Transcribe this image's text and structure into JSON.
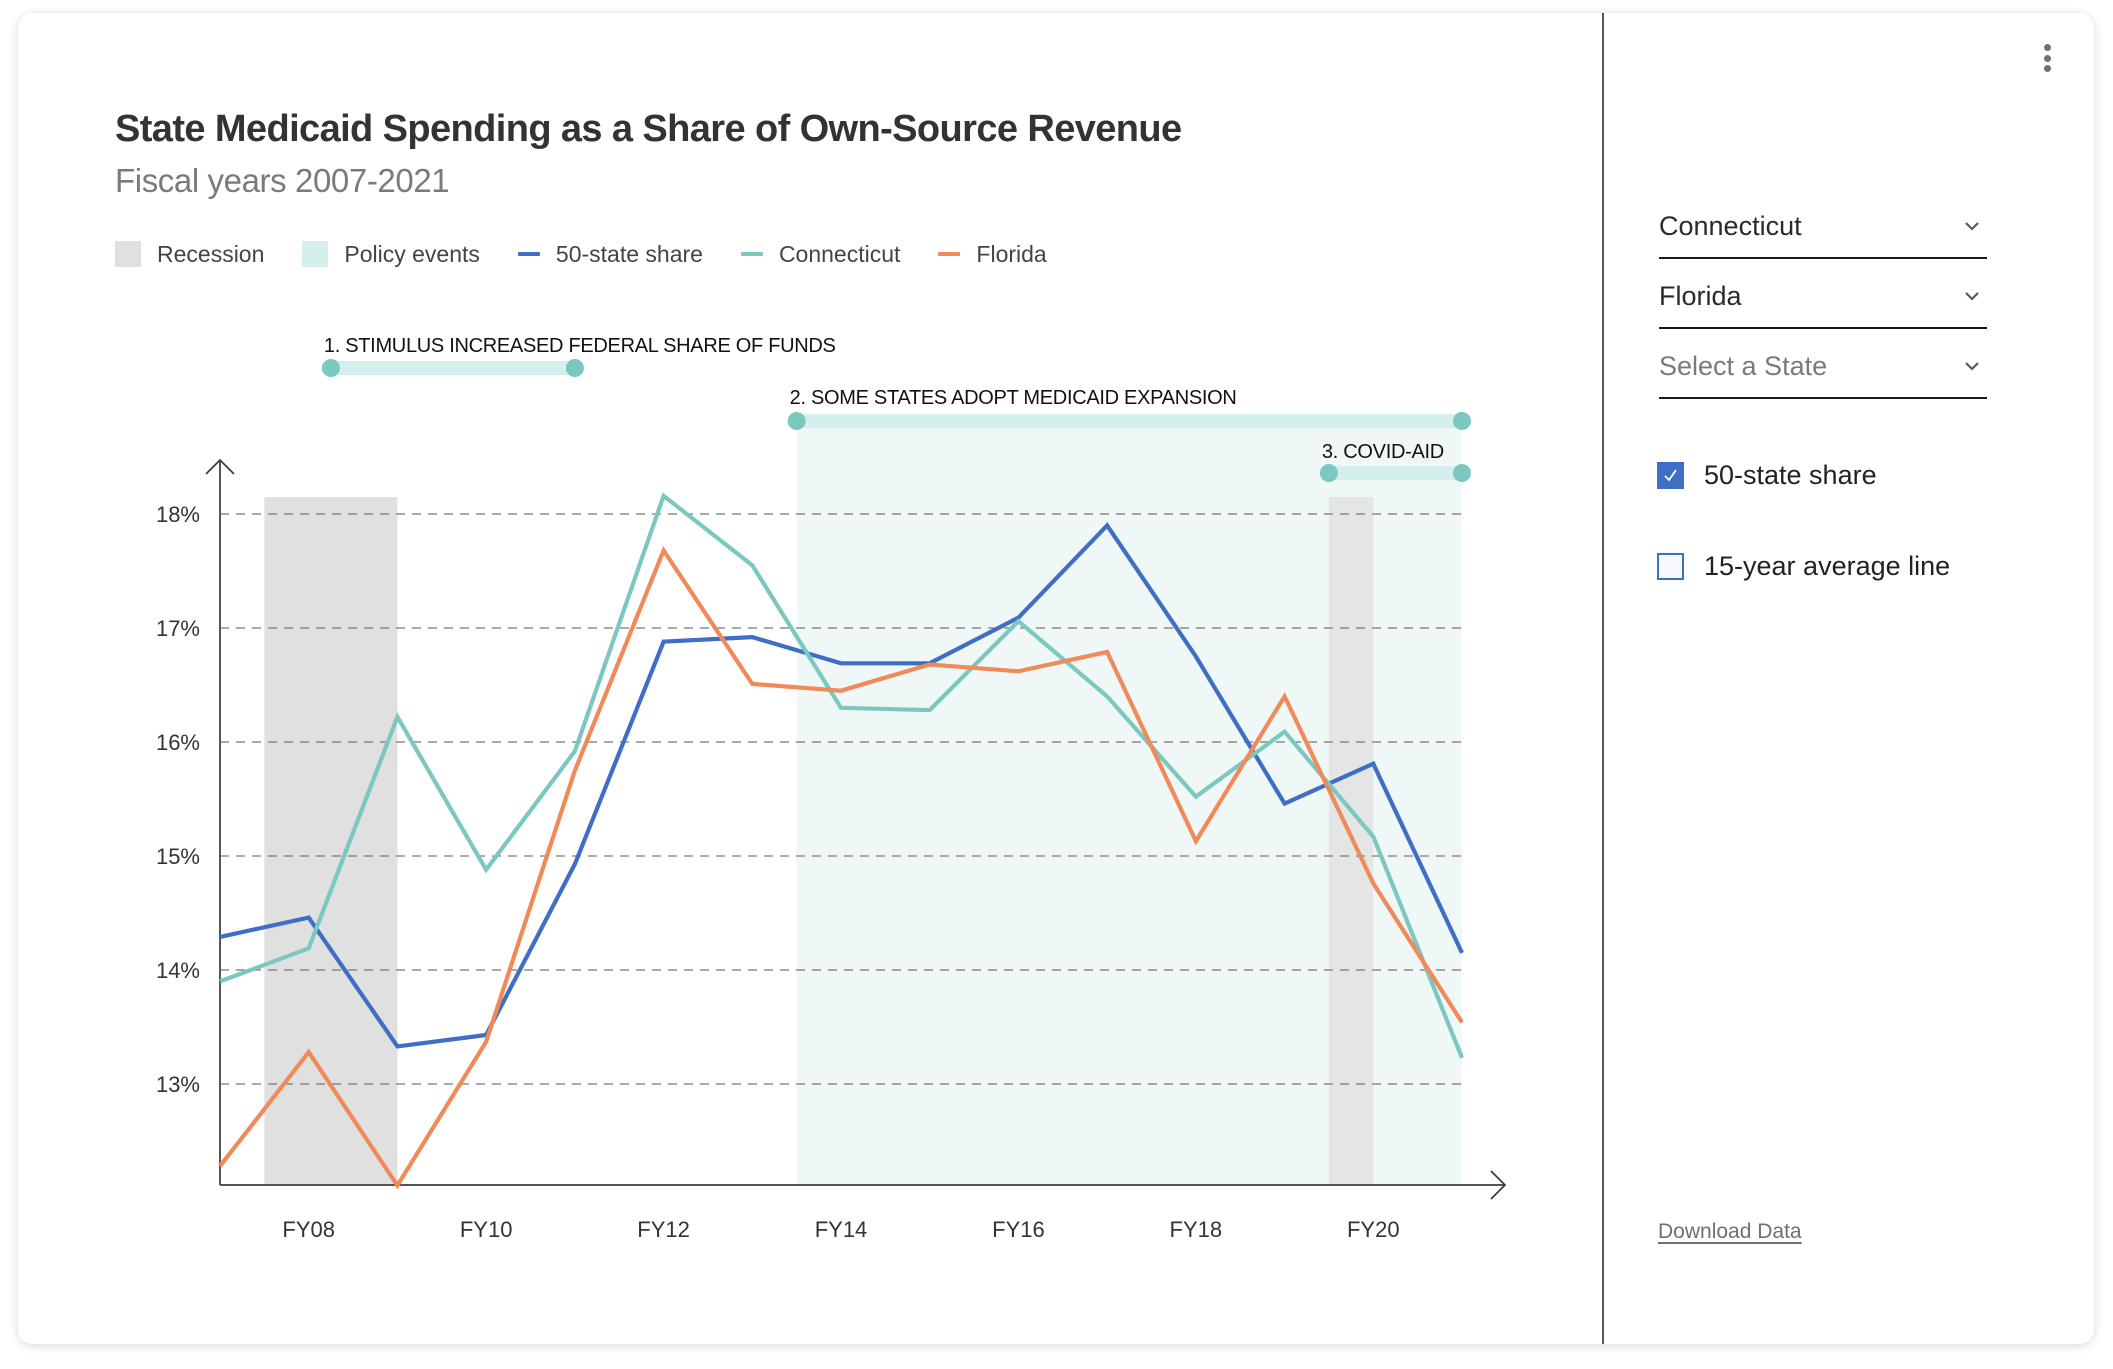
{
  "header": {
    "title": "State Medicaid Spending as a Share of Own-Source Revenue",
    "subtitle": "Fiscal years 2007-2021"
  },
  "legend": [
    {
      "label": "Recession",
      "kind": "swatch",
      "color": "#e0e0e0"
    },
    {
      "label": "Policy events",
      "kind": "swatch",
      "color": "#d5eeee"
    },
    {
      "label": "50-state share",
      "kind": "line",
      "color": "#3f6fc4"
    },
    {
      "label": "Connecticut",
      "kind": "line",
      "color": "#7ac8c0"
    },
    {
      "label": "Florida",
      "kind": "line",
      "color": "#f08a58"
    }
  ],
  "controls": {
    "menu_icon": "kebab-vertical-icon",
    "dropdowns": [
      {
        "value": "Connecticut",
        "placeholder": false
      },
      {
        "value": "Florida",
        "placeholder": false
      },
      {
        "value": "Select a State",
        "placeholder": true
      }
    ],
    "checkboxes": [
      {
        "label": "50-state share",
        "checked": true
      },
      {
        "label": "15-year average line",
        "checked": false
      }
    ],
    "download_label": "Download Data"
  },
  "colors": {
    "recession": "#e0e0e0",
    "policy_band": "#f0f8f7",
    "policy_pill": "#d5eeee",
    "policy_dot": "#7ac8c0",
    "grid": "#777777",
    "axis": "#555555"
  },
  "chart_data": {
    "type": "line",
    "title": "State Medicaid Spending as a Share of Own-Source Revenue",
    "subtitle": "Fiscal years 2007-2021",
    "xlabel": "",
    "ylabel": "",
    "x": [
      2007,
      2008,
      2009,
      2010,
      2011,
      2012,
      2013,
      2014,
      2015,
      2016,
      2017,
      2018,
      2019,
      2020,
      2021
    ],
    "x_tick_labels": [
      {
        "x": 2008,
        "label": "FY08"
      },
      {
        "x": 2010,
        "label": "FY10"
      },
      {
        "x": 2012,
        "label": "FY12"
      },
      {
        "x": 2014,
        "label": "FY14"
      },
      {
        "x": 2016,
        "label": "FY16"
      },
      {
        "x": 2018,
        "label": "FY18"
      },
      {
        "x": 2020,
        "label": "FY20"
      }
    ],
    "y_ticks": [
      {
        "value": 13,
        "label": "13%"
      },
      {
        "value": 14,
        "label": "14%"
      },
      {
        "value": 15,
        "label": "15%"
      },
      {
        "value": 16,
        "label": "16%"
      },
      {
        "value": 17,
        "label": "17%"
      },
      {
        "value": 18,
        "label": "18%"
      }
    ],
    "ylim": [
      12.11,
      18.2
    ],
    "xlim": [
      2007,
      2021
    ],
    "grid": "horizontal-dashed",
    "legend_position": "top-left",
    "series": [
      {
        "name": "50-state share",
        "color": "#3f6fc4",
        "values": [
          14.29,
          14.46,
          13.33,
          13.43,
          14.93,
          16.88,
          16.92,
          16.69,
          16.69,
          17.09,
          17.9,
          16.75,
          15.46,
          15.81,
          14.15
        ]
      },
      {
        "name": "Connecticut",
        "color": "#7ac8c0",
        "values": [
          13.9,
          14.19,
          16.22,
          14.88,
          15.92,
          18.16,
          17.55,
          16.3,
          16.28,
          17.06,
          16.4,
          15.52,
          16.09,
          15.17,
          13.23
        ]
      },
      {
        "name": "Florida",
        "color": "#f08a58",
        "values": [
          12.28,
          13.28,
          12.11,
          13.37,
          15.75,
          17.68,
          16.51,
          16.45,
          16.68,
          16.62,
          16.79,
          15.13,
          16.4,
          14.76,
          13.54
        ]
      }
    ],
    "recessions": [
      {
        "start": 2007.5,
        "end": 2009
      },
      {
        "start": 2019.5,
        "end": 2020
      }
    ],
    "policy_events": [
      {
        "label": "1. STIMULUS INCREASED FEDERAL SHARE OF FUNDS",
        "start": 2008.25,
        "end": 2011,
        "shaded": false
      },
      {
        "label": "2. SOME STATES ADOPT MEDICAID EXPANSION",
        "start": 2013.5,
        "end": 2021,
        "shaded": true
      },
      {
        "label": "3. COVID-AID",
        "start": 2019.5,
        "end": 2021,
        "shaded": false
      }
    ]
  }
}
